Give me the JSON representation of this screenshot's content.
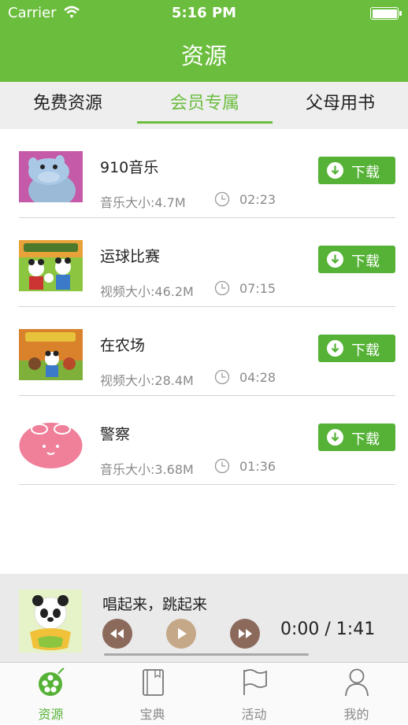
{
  "status_bar": {
    "carrier": "Carrier",
    "time": "5:16 PM"
  },
  "nav": {
    "title": "资源"
  },
  "tabs": [
    {
      "label": "免费资源",
      "active": false
    },
    {
      "label": "会员专属",
      "active": true
    },
    {
      "label": "父母用书",
      "active": false
    }
  ],
  "items": [
    {
      "title": "910音乐",
      "size": "音乐大小:4.7M",
      "duration": "02:23",
      "download": "下载",
      "thumb": "hippo-icon"
    },
    {
      "title": "运球比赛",
      "size": "视频大小:46.2M",
      "duration": "07:15",
      "download": "下载",
      "thumb": "panda-video-thumb"
    },
    {
      "title": "在农场",
      "size": "视频大小:28.4M",
      "duration": "04:28",
      "download": "下载",
      "thumb": "farm-video-thumb"
    },
    {
      "title": "警察",
      "size": "音乐大小:3.68M",
      "duration": "01:36",
      "download": "下载",
      "thumb": "bunny-icon"
    }
  ],
  "player": {
    "song": "唱起来，跳起来",
    "time": "0:00 / 1:41",
    "progress": 0
  },
  "tabbar": [
    {
      "label": "资源",
      "icon": "film-reel-icon",
      "active": true
    },
    {
      "label": "宝典",
      "icon": "book-icon",
      "active": false
    },
    {
      "label": "活动",
      "icon": "flag-icon",
      "active": false
    },
    {
      "label": "我的",
      "icon": "person-icon",
      "active": false
    }
  ],
  "colors": {
    "brand_green": "#6bbd3d",
    "button_green": "#55b236",
    "control_brown": "#8a6a5a"
  }
}
